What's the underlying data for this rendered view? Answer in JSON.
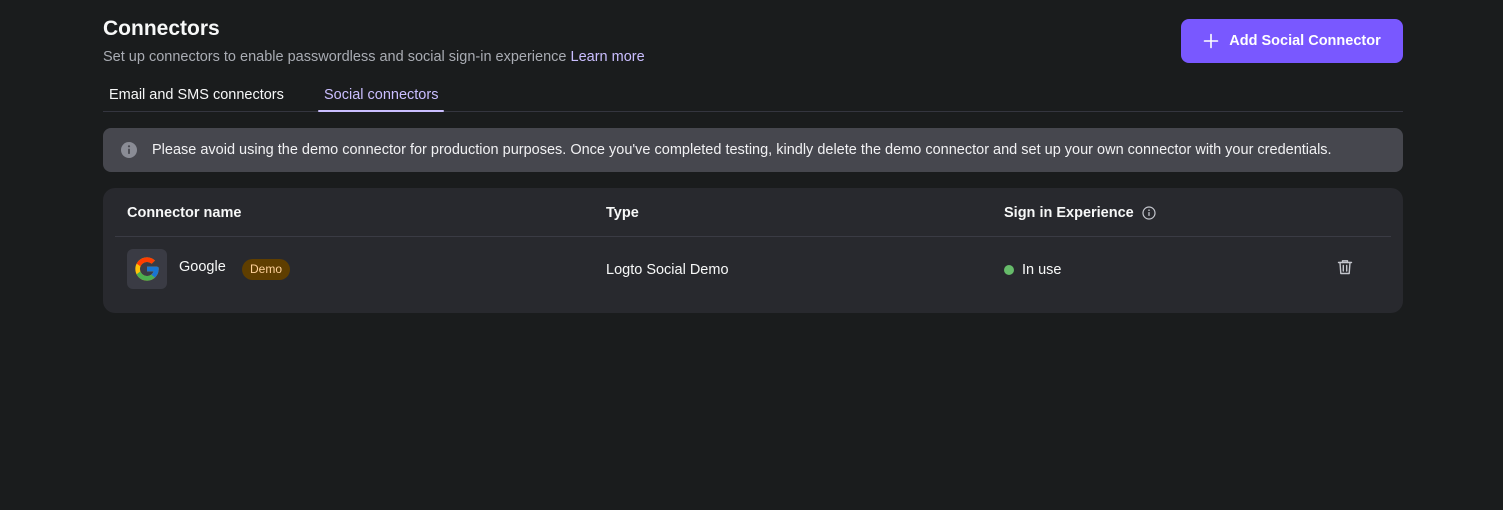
{
  "header": {
    "title": "Connectors",
    "subtitle": "Set up connectors to enable passwordless and social sign-in experience",
    "learn_more": "Learn more",
    "add_button_label": "Add Social Connector",
    "add_button_icon": "plus-icon"
  },
  "tabs": [
    {
      "label": "Email and SMS connectors",
      "active": false
    },
    {
      "label": "Social connectors",
      "active": true
    }
  ],
  "notice": {
    "icon": "info-icon",
    "text": "Please avoid using the demo connector for production purposes. Once you've completed testing, kindly delete the demo connector and set up your own connector with your credentials."
  },
  "table": {
    "columns": [
      "Connector name",
      "Type",
      "Sign in Experience"
    ],
    "rows": [
      {
        "logo": "google-logo-icon",
        "name": "Google",
        "badge": "Demo",
        "type": "Logto Social Demo",
        "status": "In use",
        "status_color": "#66bb6a"
      }
    ]
  },
  "colors": {
    "background": "#1a1c1d",
    "accent": "#7958ff",
    "link": "#cabeff",
    "badge_bg": "#5f3e00",
    "badge_text": "#ffd19a"
  }
}
